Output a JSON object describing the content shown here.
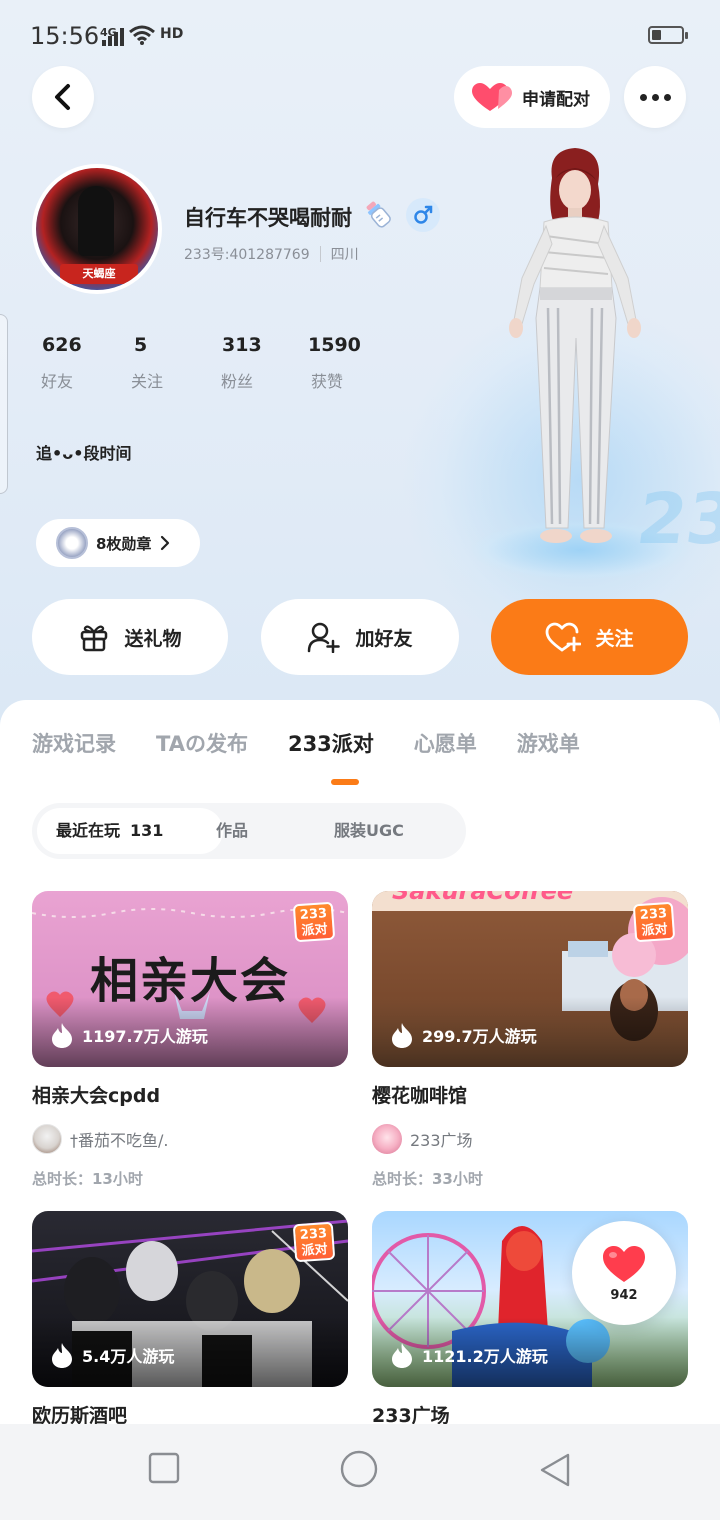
{
  "status": {
    "time": "15:56",
    "network": "4G",
    "hd": "HD"
  },
  "header": {
    "match_label": "申请配对"
  },
  "profile": {
    "name": "自行车不哭喝耐耐",
    "uid": "233号:401287769",
    "region": "四川",
    "avatar_banner": "天蝎座",
    "bio": "追•ᴗ•段时间",
    "badges_label": "8枚勋章"
  },
  "stats": [
    {
      "num": "626",
      "label": "好友"
    },
    {
      "num": "5",
      "label": "关注"
    },
    {
      "num": "313",
      "label": "粉丝"
    },
    {
      "num": "1590",
      "label": "获赞"
    }
  ],
  "actions": {
    "gift": "送礼物",
    "add_friend": "加好友",
    "follow": "关注"
  },
  "tabs": [
    "游戏记录",
    "TAの发布",
    "233派对",
    "心愿单",
    "游戏单"
  ],
  "subtabs": {
    "recent": "最近在玩",
    "recent_count": "131",
    "works": "作品",
    "ugc": "服装UGC"
  },
  "tag233": {
    "top": "233",
    "bottom": "派对"
  },
  "games": [
    {
      "title": "相亲大会cpdd",
      "plays": "1197.7万人游玩",
      "author": "†番茄不吃鱼/.",
      "duration": "总时长：13小时",
      "thumb_text": "相亲大会"
    },
    {
      "title": "樱花咖啡馆",
      "plays": "299.7万人游玩",
      "author": "233广场",
      "duration": "总时长：33小时",
      "thumb_text": "SakuraCoffee"
    },
    {
      "title": "欧历斯酒吧",
      "plays": "5.4万人游玩"
    },
    {
      "title": "233广场",
      "plays": "1121.2万人游玩"
    }
  ],
  "like_float": {
    "count": "942"
  },
  "colors": {
    "accent": "#fb7b17",
    "heart": "#ff3d4d"
  }
}
